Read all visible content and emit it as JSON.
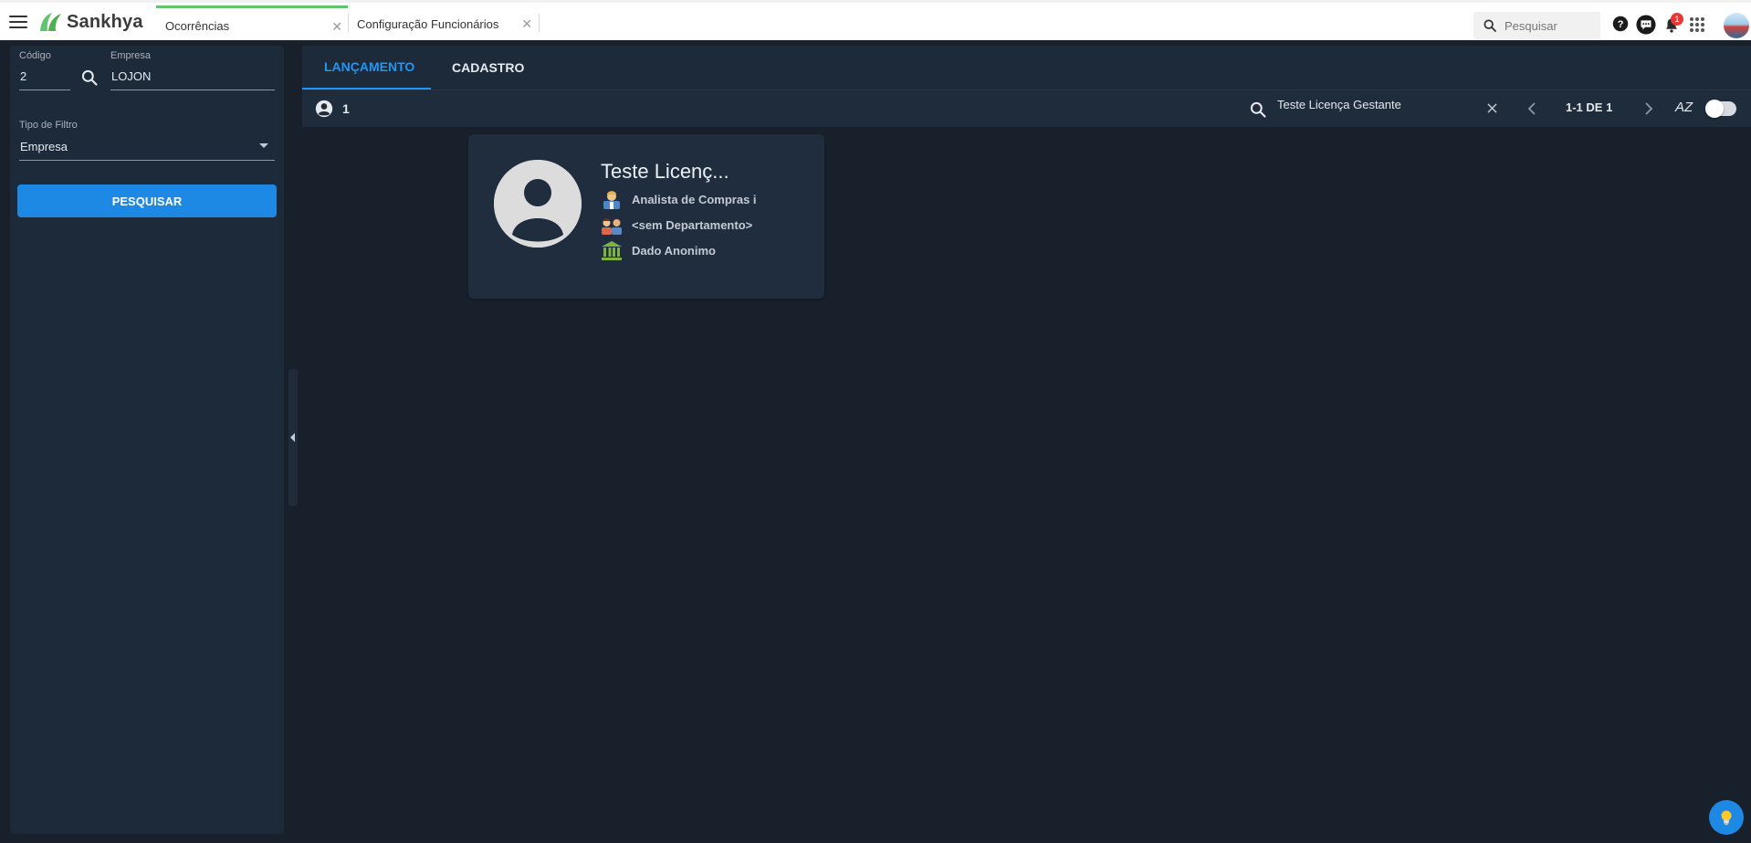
{
  "app": {
    "brand": "Sankhya"
  },
  "tabs": [
    {
      "label": "Ocorrências",
      "active": true
    },
    {
      "label": "Configuração Funcionários",
      "active": false
    }
  ],
  "global_search": {
    "placeholder": "Pesquisar"
  },
  "notifications": {
    "count": "1"
  },
  "filters": {
    "codigo": {
      "label": "Código",
      "value": "2"
    },
    "empresa": {
      "label": "Empresa",
      "value": "LOJON"
    },
    "tipo_filtro": {
      "label": "Tipo de Filtro",
      "value": "Empresa"
    },
    "search_button": "PESQUISAR"
  },
  "main_tabs": [
    {
      "label": "LANÇAMENTO",
      "active": true
    },
    {
      "label": "CADASTRO",
      "active": false
    }
  ],
  "toolbar": {
    "count": "1",
    "search_value": "Teste Licença Gestante",
    "pagination": "1-1 DE 1",
    "sort_label": "AZ"
  },
  "card": {
    "name": "Teste Licenç...",
    "cargo": "Analista de Compras i",
    "departamento": "<sem Departamento>",
    "banco": "Dado Anonimo"
  },
  "colors": {
    "accent": "#1e88e5",
    "brand_green": "#5fc46b",
    "background": "#18202b",
    "panel": "#1d2a3a"
  }
}
